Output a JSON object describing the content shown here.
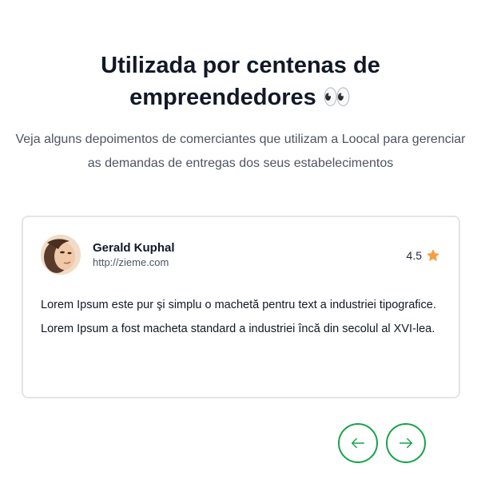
{
  "header": {
    "title_line1": "Utilizada por centenas de",
    "title_line2": "empreendedores",
    "title_emoji": "👀",
    "subtitle": "Veja alguns depoimentos de comerciantes que utilizam a Loocal para gerenciar as demandas de entregas dos seus estabelecimentos"
  },
  "testimonial": {
    "name": "Gerald Kuphal",
    "website": "http://zieme.com",
    "rating": "4.5",
    "rating_icon": "star-icon",
    "paragraphs": [
      "Lorem Ipsum este pur şi simplu o machetă pentru text a industriei tipografice.",
      "Lorem Ipsum a fost macheta standard a industriei încă din secolul al XVI-lea."
    ]
  },
  "navigation": {
    "prev_icon": "arrow-left-icon",
    "next_icon": "arrow-right-icon"
  },
  "colors": {
    "accent": "#16a34a",
    "star": "#f59e42",
    "text_muted": "#4b5563"
  }
}
